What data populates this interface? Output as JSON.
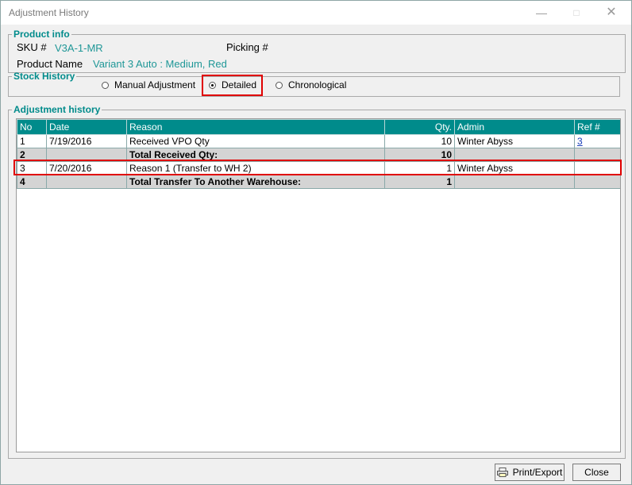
{
  "window": {
    "title": "Adjustment History"
  },
  "product_info": {
    "legend": "Product info",
    "sku_label": "SKU #",
    "sku_value": "V3A-1-MR",
    "picking_label": "Picking #",
    "picking_value": "",
    "name_label": "Product Name",
    "name_value": "Variant 3 Auto : Medium, Red"
  },
  "stock_history": {
    "legend": "Stock History",
    "options": [
      "Manual Adjustment",
      "Detailed",
      "Chronological"
    ],
    "selected": "Detailed"
  },
  "adjustment_history": {
    "legend": "Adjustment history",
    "columns": [
      "No",
      "Date",
      "Reason",
      "Qty.",
      "Admin",
      "Ref #"
    ],
    "rows": [
      {
        "no": "1",
        "date": "7/19/2016",
        "reason": "Received VPO Qty",
        "qty": "10",
        "admin": "Winter Abyss",
        "ref": "3",
        "total": false
      },
      {
        "no": "2",
        "date": "",
        "reason": "Total Received Qty:",
        "qty": "10",
        "admin": "",
        "ref": "",
        "total": true
      },
      {
        "no": "3",
        "date": "7/20/2016",
        "reason": "Reason 1 (Transfer to WH 2)",
        "qty": "1",
        "admin": "Winter Abyss",
        "ref": "",
        "total": false
      },
      {
        "no": "4",
        "date": "",
        "reason": "Total Transfer To Another Warehouse:",
        "qty": "1",
        "admin": "",
        "ref": "",
        "total": true
      }
    ]
  },
  "buttons": {
    "print_export": "Print/Export",
    "close": "Close"
  },
  "icons": {
    "minimize": "minimize-icon",
    "maximize": "maximize-icon",
    "close": "close-icon",
    "printer": "printer-icon"
  },
  "colors": {
    "accent": "#008b8b",
    "highlight": "#e00000",
    "total_row": "#d4d4d4"
  }
}
